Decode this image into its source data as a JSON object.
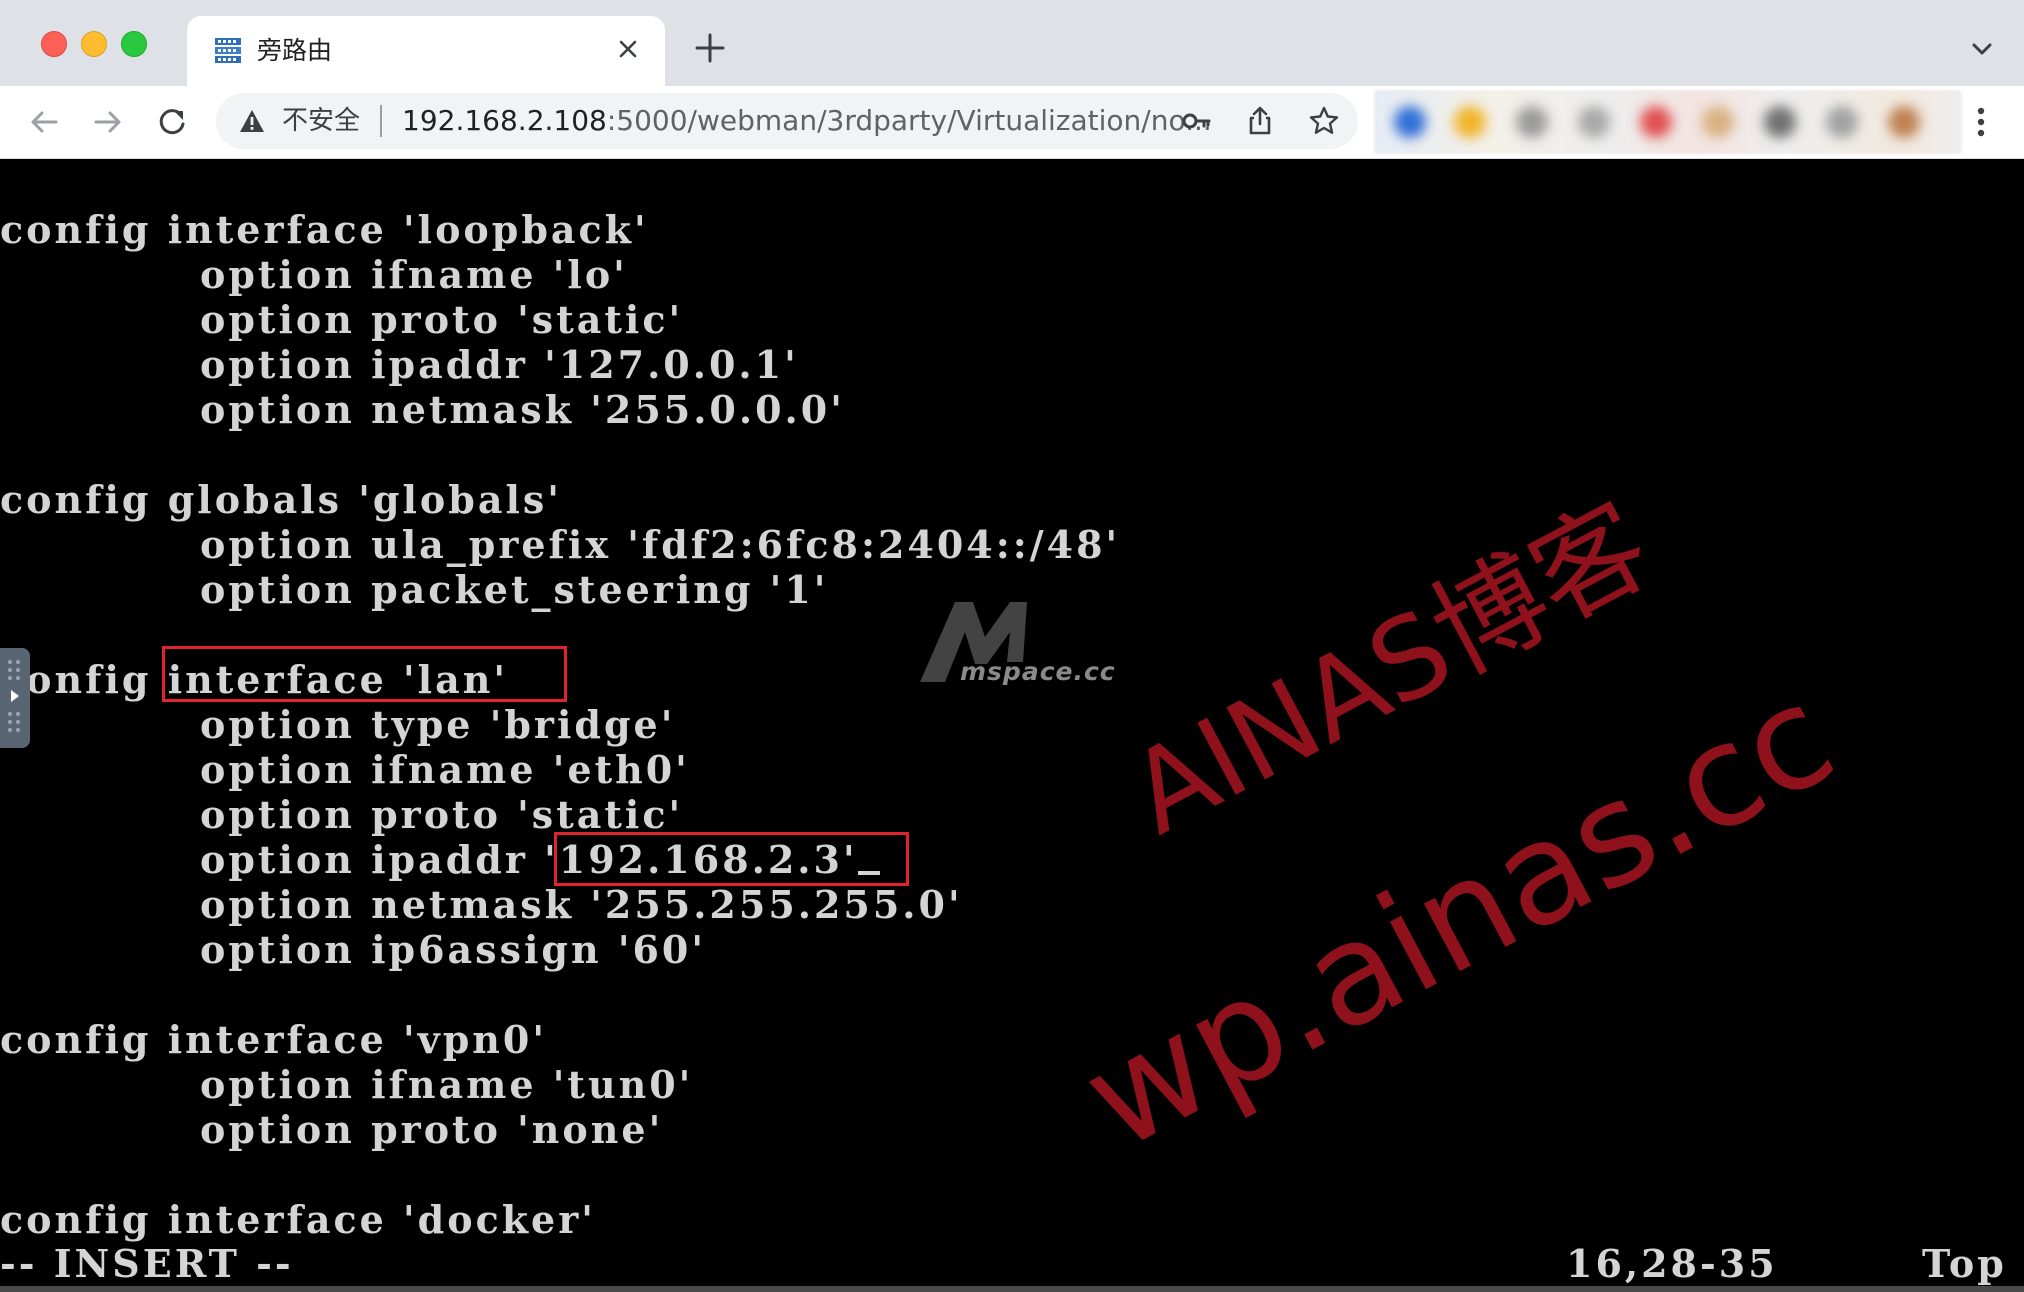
{
  "browser": {
    "tab_title": "旁路由",
    "security_label": "不安全",
    "url_host": "192.168.2.108",
    "url_path": ":5000/webman/3rdparty/Virtualization/no..."
  },
  "icons": {
    "back": "back-arrow-icon",
    "forward": "forward-arrow-icon",
    "reload": "reload-icon",
    "warning": "warning-triangle-icon",
    "key": "key-icon",
    "share": "share-icon",
    "star": "star-icon",
    "menu": "kebab-menu-icon",
    "new_tab": "plus-icon",
    "tab_close": "close-icon",
    "tab_list": "chevron-down-icon",
    "favicon": "server-grid-icon"
  },
  "terminal": {
    "lines": [
      "config interface 'loopback'",
      "option ifname 'lo'",
      "option proto 'static'",
      "option ipaddr '127.0.0.1'",
      "option netmask '255.0.0.0'",
      "",
      "config globals 'globals'",
      "option ula_prefix 'fdf2:6fc8:2404::/48'",
      "option packet_steering '1'",
      "",
      "config interface 'lan'",
      "option type 'bridge'",
      "option ifname 'eth0'",
      "option proto 'static'",
      "option ipaddr '192.168.2.3'",
      "option netmask '255.255.255.0'",
      "option ip6assign '60'",
      "",
      "config interface 'vpn0'",
      "option ifname 'tun0'",
      "option proto 'none'",
      "",
      "config interface 'docker'"
    ],
    "status_mode": "-- INSERT --",
    "status_position": "16,28-35",
    "status_scroll": "Top"
  },
  "watermarks": {
    "logo_text": "mspace.cc",
    "red_line_1": "AINAS博客",
    "red_line_2": "wp.ainas.cc"
  },
  "colors": {
    "highlight_box": "#e0232c",
    "watermark_red": "#96121e",
    "terminal_fg": "#d4d4d4",
    "terminal_bg": "#000000"
  }
}
